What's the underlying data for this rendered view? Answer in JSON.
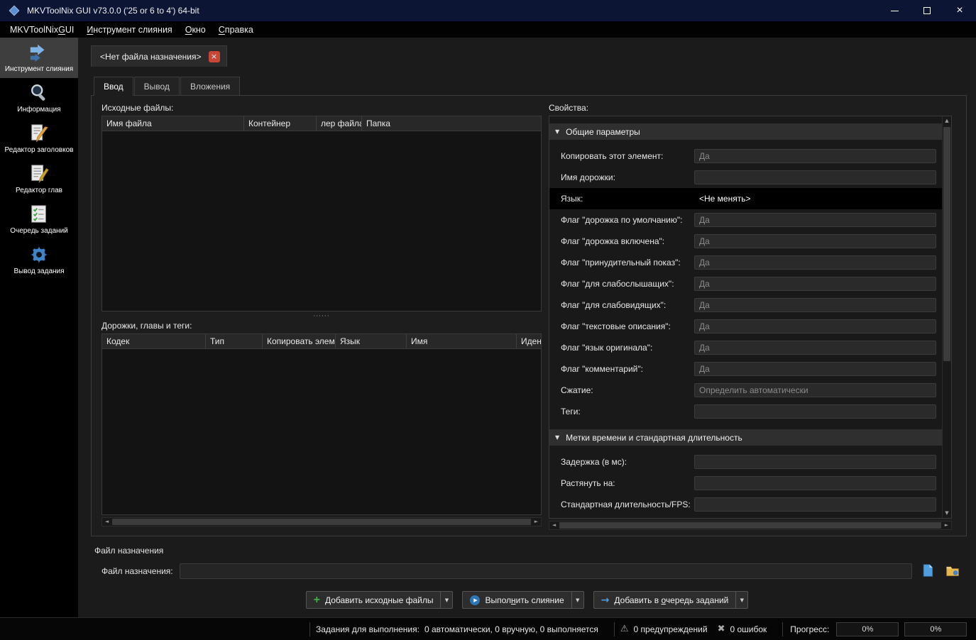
{
  "window": {
    "title": "MKVToolNix GUI v73.0.0 ('25 or 6 to 4') 64-bit"
  },
  "icons": {
    "close": "×",
    "tab_close": "×",
    "triangle_down": "▼",
    "dropdown": "▼",
    "scroll_up": "▲",
    "scroll_down": "▼",
    "scroll_left": "◄",
    "scroll_right": "►",
    "splitter_dots": "······",
    "plus": "+",
    "play": "▶",
    "arrow_right": "→",
    "warning": "⚠",
    "error": "✖"
  },
  "menu": {
    "items": [
      {
        "name": "mkvtoolnix-gui",
        "label": "MKVToolNix GUI",
        "accel": 11
      },
      {
        "name": "merge-tool",
        "label": "Инструмент слияния",
        "accel": 0
      },
      {
        "name": "window",
        "label": "Окно",
        "accel": 0
      },
      {
        "name": "help",
        "label": "Справка",
        "accel": 0
      }
    ]
  },
  "sidebar": {
    "items": [
      {
        "name": "merge-tool",
        "label": "Инструмент слияния",
        "active": true
      },
      {
        "name": "info-tool",
        "label": "Информация",
        "active": false
      },
      {
        "name": "header-editor",
        "label": "Редактор заголовков",
        "active": false
      },
      {
        "name": "chapter-editor",
        "label": "Редактор глав",
        "active": false
      },
      {
        "name": "job-queue",
        "label": "Очередь заданий",
        "active": false
      },
      {
        "name": "job-output",
        "label": "Вывод задания",
        "active": false
      }
    ]
  },
  "doc_tab": {
    "label": "<Нет файла назначения>"
  },
  "sub_tabs": [
    {
      "name": "input",
      "label": "Ввод",
      "active": true
    },
    {
      "name": "output",
      "label": "Вывод",
      "active": false
    },
    {
      "name": "attachments",
      "label": "Вложения",
      "active": false
    }
  ],
  "source_files": {
    "label": "Исходные файлы:",
    "columns": [
      "Имя файла",
      "Контейнер",
      "лер файла",
      "Папка"
    ]
  },
  "tracks": {
    "label": "Дорожки, главы и теги:",
    "columns": [
      "Кодек",
      "Тип",
      "Копировать элем",
      "Язык",
      "Имя",
      "Иден"
    ]
  },
  "properties": {
    "label": "Свойства:",
    "sections": [
      {
        "title": "Общие параметры",
        "rows": [
          {
            "label": "Копировать этот элемент:",
            "value": "Да",
            "state": "disabled"
          },
          {
            "label": "Имя дорожки:",
            "value": "",
            "state": "disabled"
          },
          {
            "label": "Язык:",
            "value": "<Не менять>",
            "state": "selected"
          },
          {
            "label": "Флаг \"дорожка по умолчанию\":",
            "value": "Да",
            "state": "disabled"
          },
          {
            "label": "Флаг \"дорожка включена\":",
            "value": "Да",
            "state": "disabled"
          },
          {
            "label": "Флаг \"принудительный показ\":",
            "value": "Да",
            "state": "disabled"
          },
          {
            "label": "Флаг \"для слабослышащих\":",
            "value": "Да",
            "state": "disabled"
          },
          {
            "label": "Флаг \"для слабовидящих\":",
            "value": "Да",
            "state": "disabled"
          },
          {
            "label": "Флаг \"текстовые описания\":",
            "value": "Да",
            "state": "disabled"
          },
          {
            "label": "Флаг \"язык оригинала\":",
            "value": "Да",
            "state": "disabled"
          },
          {
            "label": "Флаг \"комментарий\":",
            "value": "Да",
            "state": "disabled"
          },
          {
            "label": "Сжатие:",
            "value": "Определить автоматически",
            "state": "disabled"
          },
          {
            "label": "Теги:",
            "value": "",
            "state": "disabled"
          }
        ]
      },
      {
        "title": "Метки времени и стандартная длительность",
        "rows": [
          {
            "label": "Задержка (в мс):",
            "value": "",
            "state": "disabled"
          },
          {
            "label": "Растянуть на:",
            "value": "",
            "state": "disabled"
          },
          {
            "label": "Стандартная длительность/FPS:",
            "value": "",
            "state": "disabled"
          }
        ]
      }
    ]
  },
  "destination": {
    "group_label": "Файл назначения",
    "field_label": "Файл назначения:",
    "value": ""
  },
  "actions": [
    {
      "name": "add-source-files",
      "label": "Добавить исходные файлы",
      "accel": 0,
      "icon": "plus",
      "split": true
    },
    {
      "name": "start-muxing",
      "label": "Выполнить слияние",
      "accel": 5,
      "icon": "play",
      "split": true
    },
    {
      "name": "add-to-job-queue",
      "label": "Добавить в очередь заданий",
      "accel": 11,
      "icon": "arrow_right",
      "split": true
    }
  ],
  "status_bar": {
    "jobs_label": "Задания для выполнения:",
    "jobs_value": "0 автоматически, 0 вручную, 0 выполняется",
    "warnings": "0 предупреждений",
    "errors": "0 ошибок",
    "progress_label": "Прогресс:",
    "progress_current": "0%",
    "progress_total": "0%"
  }
}
